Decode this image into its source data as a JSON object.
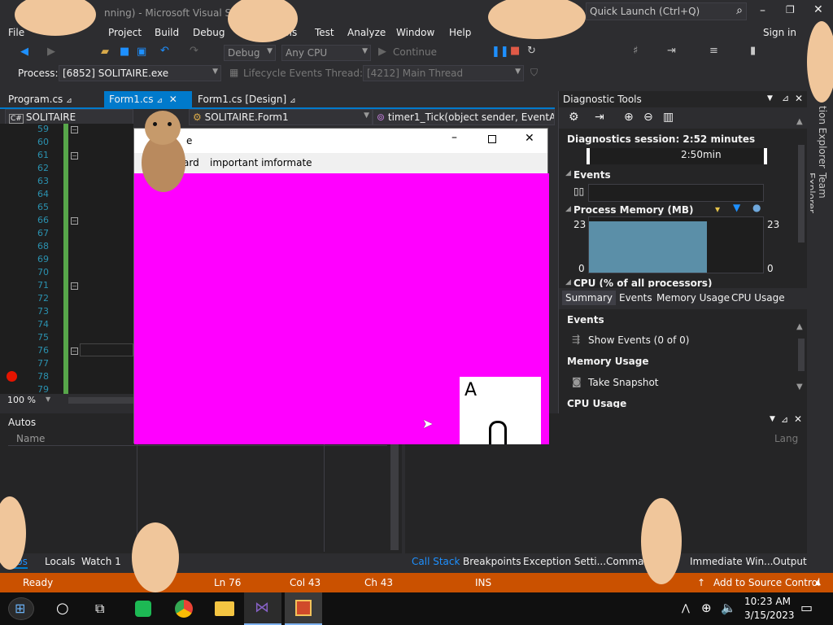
{
  "window": {
    "title": "SOLITAIRE (Running) - Microsoft Visual Studio",
    "title_visible": "nning) - Microsoft Visual Studi",
    "quick_launch_placeholder": "Quick Launch (Ctrl+Q)",
    "sign_in": "Sign in"
  },
  "menu": [
    "File",
    "Edit",
    "View",
    "Project",
    "Build",
    "Debug",
    "Team",
    "Tools",
    "Test",
    "Analyze",
    "Window",
    "Help"
  ],
  "menu_visible": {
    "file": "File",
    "project": "Project",
    "build": "Build",
    "debug": "Debug",
    "tools": "ools",
    "test": "Test",
    "analyze": "Analyze",
    "window": "Window",
    "help": "Help"
  },
  "toolbar": {
    "config": "Debug",
    "platform": "Any CPU",
    "continue": "Continue"
  },
  "processbar": {
    "process_label": "Process:",
    "process_value": "[6852] SOLITAIRE.exe",
    "lifecycle": "Lifecycle Events",
    "thread_label": "Thread:",
    "thread_value": "[4212] Main Thread"
  },
  "doc_tabs": [
    {
      "label": "Program.cs",
      "active": false
    },
    {
      "label": "Form1.cs",
      "active": true
    },
    {
      "label": "Form1.cs [Design]",
      "active": false
    }
  ],
  "nav": {
    "project": "SOLITAIRE",
    "class": "SOLITAIRE.Form1",
    "member": "timer1_Tick(object sender, EventArg"
  },
  "editor": {
    "line_numbers": [
      "59",
      "60",
      "61",
      "62",
      "63",
      "64",
      "65",
      "66",
      "67",
      "68",
      "69",
      "70",
      "71",
      "72",
      "73",
      "74",
      "75",
      "76",
      "77",
      "78",
      "79"
    ],
    "zoom": "100 %"
  },
  "form_window": {
    "title_fragment": "e",
    "menu_items": [
      "ard",
      "important imformate"
    ],
    "card_letter": "A"
  },
  "diagnostic": {
    "title": "Diagnostic Tools",
    "session": "Diagnostics session: 2:52 minutes",
    "time_mark": "2:50min",
    "events_heading": "Events",
    "process_memory": "Process Memory (MB)",
    "mem_max": "23",
    "mem_min": "0",
    "cpu_heading": "CPU (% of all processors)",
    "tabs": [
      "Summary",
      "Events",
      "Memory Usage",
      "CPU Usage"
    ],
    "sections": [
      {
        "heading": "Events",
        "action": "Show Events (0 of 0)"
      },
      {
        "heading": "Memory Usage",
        "action": "Take Snapshot"
      },
      {
        "heading": "CPU Usage",
        "action": ""
      }
    ],
    "memory_level": 0.93
  },
  "side_tabs": [
    "Solution Explorer",
    "Team Explorer"
  ],
  "side_tabs_visible": [
    "tion Explorer",
    "Team Explorer"
  ],
  "autos": {
    "title": "Autos",
    "col_name": "Name",
    "col_lang": "Lang"
  },
  "bottom_tabs_left": [
    "Autos",
    "Locals",
    "Watch 1"
  ],
  "bottom_tabs_left_visible": [
    "utos",
    "Locals",
    "Watch 1"
  ],
  "bottom_tabs_right": [
    "Call Stack",
    "Breakpoints",
    "Exception Setti...",
    "Command ...",
    "Immediate Win...",
    "Output"
  ],
  "status": {
    "ready": "Ready",
    "ln": "Ln 76",
    "col": "Col 43",
    "ch": "Ch 43",
    "ins": "INS",
    "source_control": "Add to Source Control"
  },
  "taskbar": {
    "time": "10:23 AM",
    "date": "3/15/2023"
  },
  "colors": {
    "accent": "#007acc",
    "status": "#ca5100",
    "form_bg": "#ff00ff",
    "tab_active": "#007acc"
  }
}
